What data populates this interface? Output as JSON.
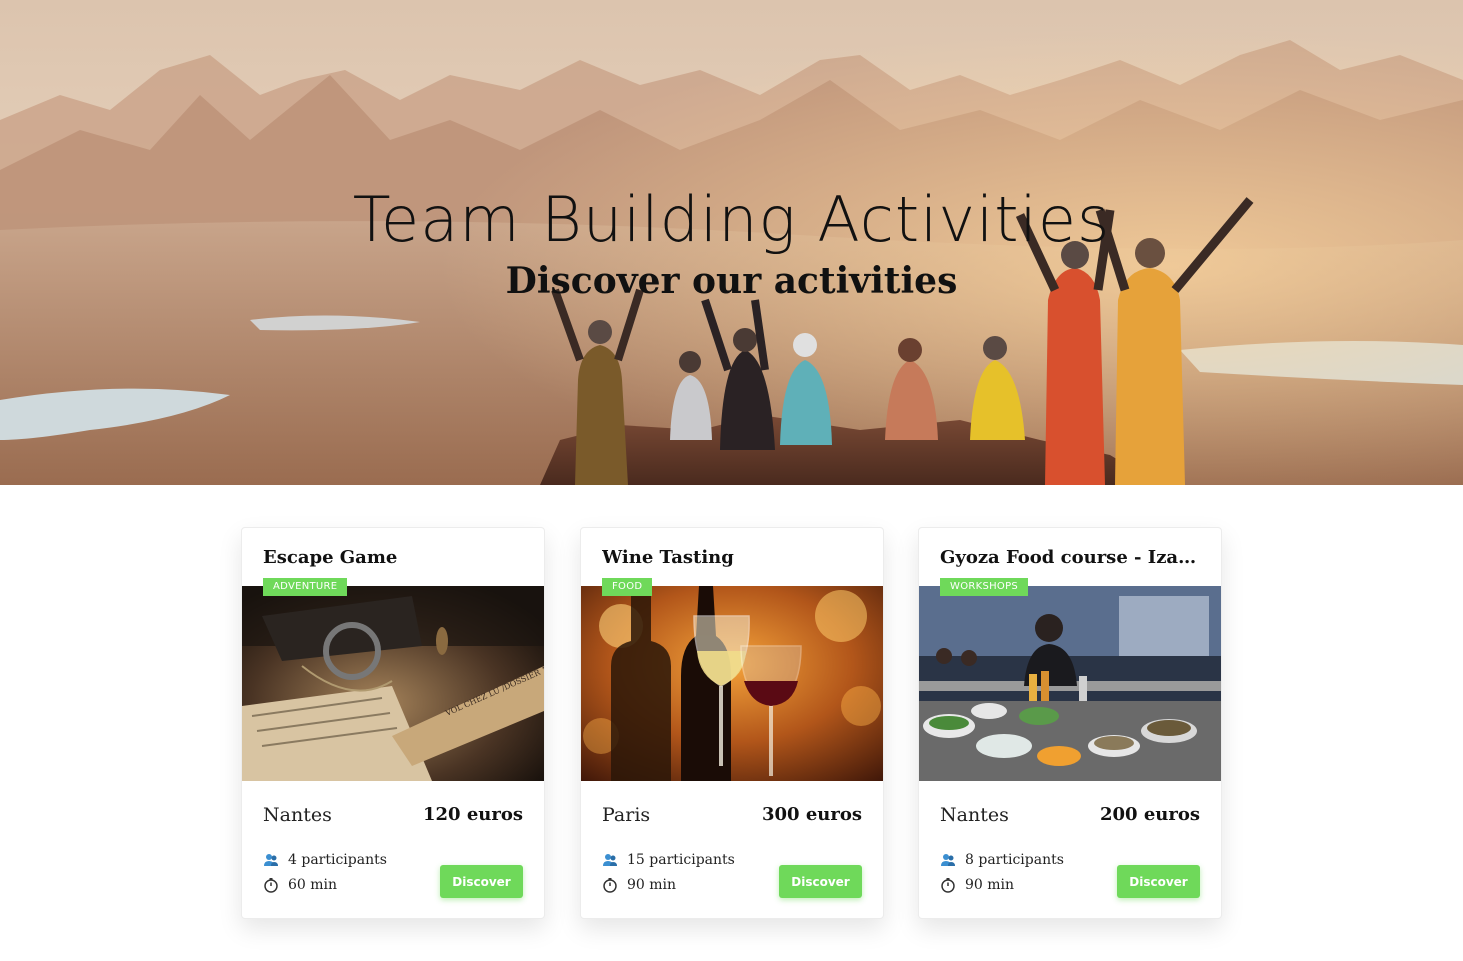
{
  "hero": {
    "title": "Team Building Activities",
    "subtitle": "Discover our activities"
  },
  "activities": [
    {
      "title": "Escape Game",
      "tag": "Adventure",
      "city": "Nantes",
      "price": "120 euros",
      "participants": "4 participants",
      "duration": "60 min",
      "button": "Discover",
      "image_text": "VOL CHEZ LU /DOSSIER 1"
    },
    {
      "title": "Wine Tasting",
      "tag": "Food",
      "city": "Paris",
      "price": "300 euros",
      "participants": "15 participants",
      "duration": "90 min",
      "button": "Discover"
    },
    {
      "title": "Gyoza Food course - Izakaya",
      "tag": "Workshops",
      "city": "Nantes",
      "price": "200 euros",
      "participants": "8 participants",
      "duration": "90 min",
      "button": "Discover"
    }
  ],
  "icons": {
    "participants": "people-icon",
    "duration": "stopwatch-icon"
  },
  "colors": {
    "accent_green": "#6fd95a",
    "participants_icon": "#3b8fd1"
  }
}
